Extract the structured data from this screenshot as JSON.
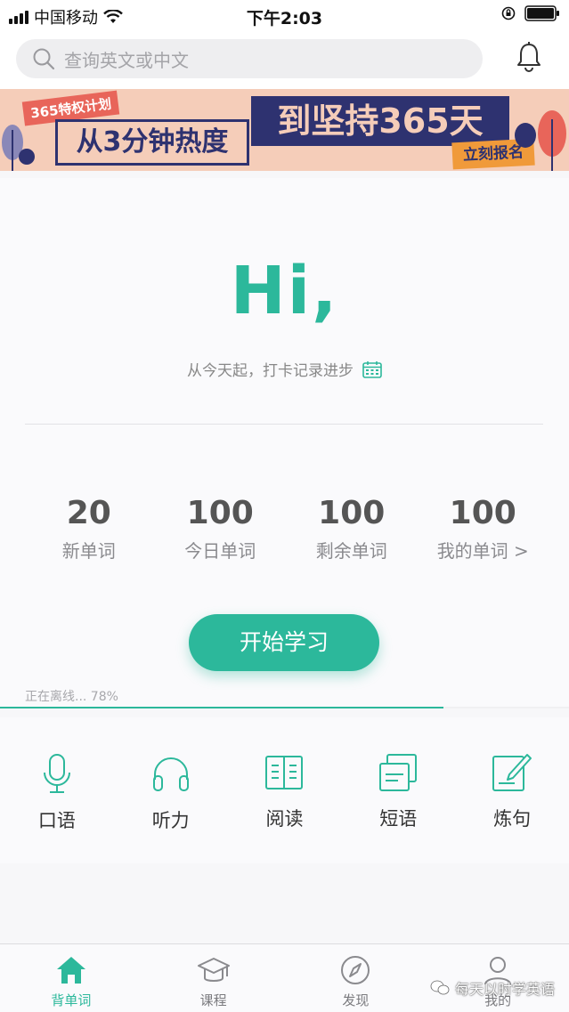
{
  "status_bar": {
    "carrier": "中国移动",
    "time": "下午2:03"
  },
  "search": {
    "placeholder": "查询英文或中文"
  },
  "banner": {
    "tag": "365特权计划",
    "line1": "从3分钟热度",
    "line2": "到坚持365天",
    "cta": "立刻报名"
  },
  "hero": {
    "greeting": "Hi,",
    "subtitle": "从今天起，打卡记录进步"
  },
  "stats": [
    {
      "value": "20",
      "label": "新单词"
    },
    {
      "value": "100",
      "label": "今日单词"
    },
    {
      "value": "100",
      "label": "剩余单词"
    },
    {
      "value": "100",
      "label": "我的单词 >"
    }
  ],
  "start_button": "开始学习",
  "offline": {
    "text": "正在离线... 78%",
    "progress": 0.78
  },
  "tools": [
    {
      "label": "口语",
      "icon": "microphone-icon"
    },
    {
      "label": "听力",
      "icon": "headphones-icon"
    },
    {
      "label": "阅读",
      "icon": "book-icon"
    },
    {
      "label": "短语",
      "icon": "cards-icon"
    },
    {
      "label": "炼句",
      "icon": "edit-icon"
    }
  ],
  "tabs": [
    {
      "label": "背单词",
      "icon": "home-icon",
      "active": true
    },
    {
      "label": "课程",
      "icon": "graduation-cap-icon",
      "active": false
    },
    {
      "label": "发现",
      "icon": "compass-icon",
      "active": false
    },
    {
      "label": "我的",
      "icon": "user-icon",
      "active": false
    }
  ],
  "watermark": "每天以时学英语",
  "colors": {
    "accent": "#2cb89b",
    "banner_bg": "#f5cdb9",
    "banner_navy": "#2e3270"
  }
}
